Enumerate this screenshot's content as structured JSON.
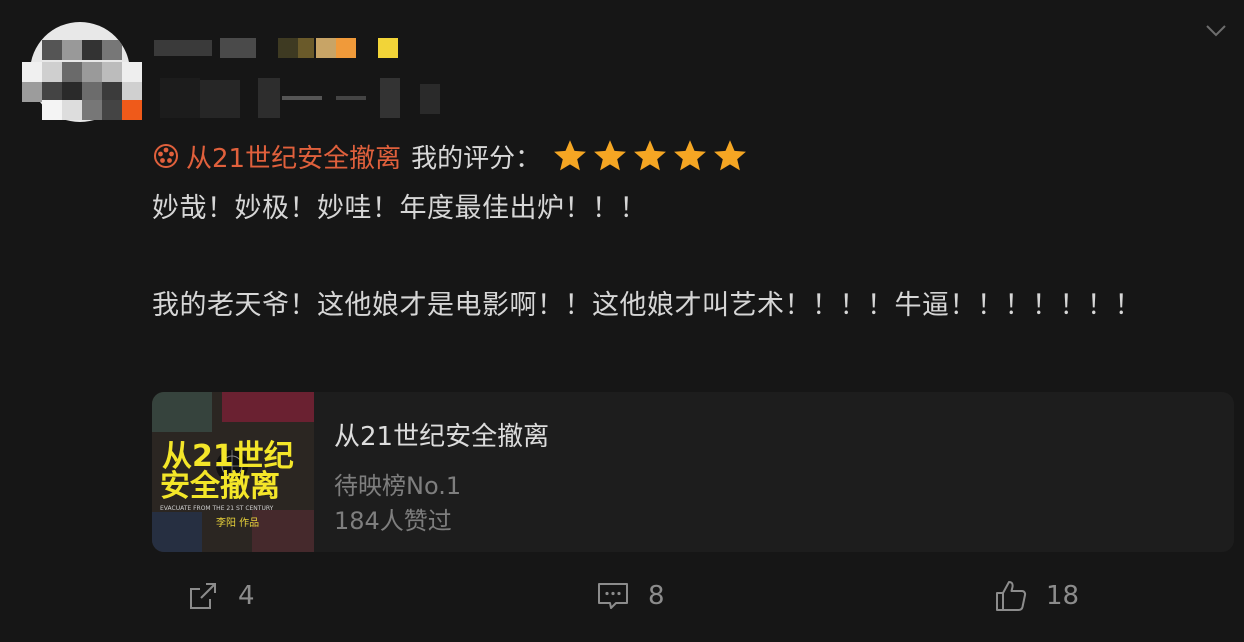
{
  "post": {
    "movie_title": "从21世纪安全撤离",
    "rating_label": "我的评分：",
    "stars": 5,
    "line1": "妙哉！妙极！妙哇！年度最佳出炉！！！",
    "line2": "我的老天爷！这他娘才是电影啊！！这他娘才叫艺术！！！！牛逼！！！！！！！"
  },
  "card": {
    "title": "从21世纪安全撤离",
    "rank": "待映榜No.1",
    "likes": "184人赞过",
    "poster_title_line1": "从21世纪",
    "poster_title_line2": "安全撤离",
    "poster_subtitle": "EVACUATE FROM THE 21 ST CENTURY",
    "poster_credit": "李阳 作品"
  },
  "actions": {
    "share_count": "4",
    "comment_count": "8",
    "like_count": "18"
  },
  "colors": {
    "accent": "#e0603c",
    "star": "#f5a623",
    "background": "#161616",
    "card": "#1d1d1d"
  }
}
